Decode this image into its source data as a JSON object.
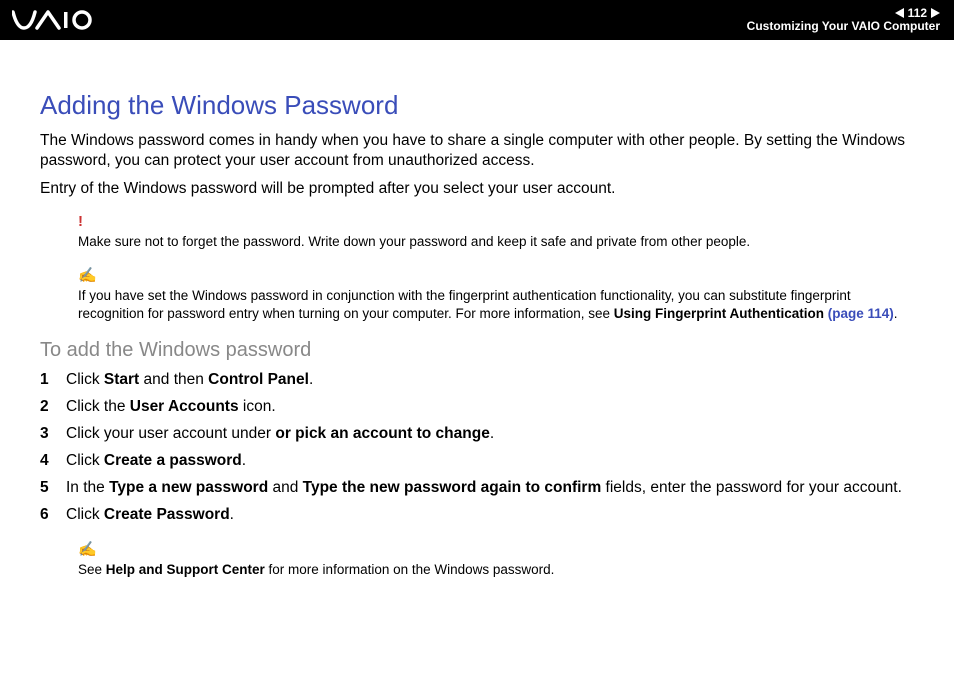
{
  "header": {
    "page_number": "112",
    "breadcrumb": "Customizing Your VAIO Computer"
  },
  "page": {
    "title": "Adding the Windows Password",
    "para1": "The Windows password comes in handy when you have to share a single computer with other people. By setting the Windows password, you can protect your user account from unauthorized access.",
    "para2": "Entry of the Windows password will be prompted after you select your user account."
  },
  "warning_note": {
    "text": "Make sure not to forget the password. Write down your password and keep it safe and private from other people."
  },
  "tip_note1": {
    "prefix": "If you have set the Windows password in conjunction with the fingerprint authentication functionality, you can substitute fingerprint recognition for password entry when turning on your computer. For more information, see ",
    "bold": "Using Fingerprint Authentication",
    "link": " (page 114)",
    "suffix": "."
  },
  "subtitle": "To add the Windows password",
  "steps": [
    {
      "pre": "Click ",
      "b1": "Start",
      "mid": " and then ",
      "b2": "Control Panel",
      "post": "."
    },
    {
      "pre": "Click the ",
      "b1": "User Accounts",
      "mid": " icon.",
      "b2": "",
      "post": ""
    },
    {
      "pre": "Click your user account under ",
      "b1": "or pick an account to change",
      "mid": ".",
      "b2": "",
      "post": ""
    },
    {
      "pre": "Click ",
      "b1": "Create a password",
      "mid": ".",
      "b2": "",
      "post": ""
    },
    {
      "pre": "In the ",
      "b1": "Type a new password",
      "mid": " and ",
      "b2": "Type the new password again to confirm",
      "post": " fields, enter the password for your account."
    },
    {
      "pre": "Click ",
      "b1": "Create Password",
      "mid": ".",
      "b2": "",
      "post": ""
    }
  ],
  "tip_note2": {
    "prefix": "See ",
    "bold": "Help and Support Center",
    "suffix": " for more information on the Windows password."
  }
}
